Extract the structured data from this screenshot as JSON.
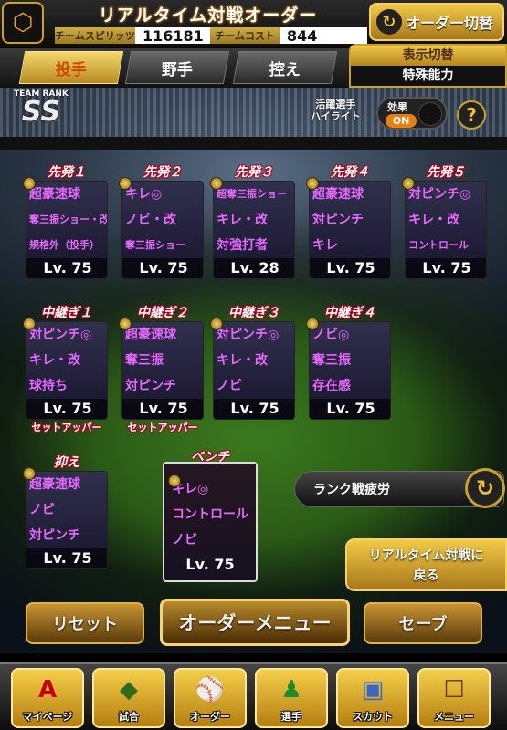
{
  "header": {
    "title": "リアルタイム対戦オーダー",
    "team_spirit_label": "チームスピリッツ",
    "team_spirit_value": "116181",
    "team_cost_label": "チームコスト",
    "team_cost_value": "844",
    "order_change_label": "オーダー切替"
  },
  "tabs": [
    {
      "label": "投手",
      "active": true
    },
    {
      "label": "野手",
      "active": false
    },
    {
      "label": "控え",
      "active": false
    }
  ],
  "display_switch": {
    "title": "表示切替",
    "value": "特殊能力"
  },
  "team_rank": {
    "label": "TEAM RANK",
    "value": "SS"
  },
  "highlight": {
    "label_line1": "活躍選手",
    "label_line2": "ハイライト",
    "effect_label": "効果",
    "state": "ON"
  },
  "starters": [
    {
      "pos": "先発１",
      "abilities": [
        "超豪速球",
        "奪三振ショー・改",
        "規格外（投手）"
      ],
      "level": "Lv. 75"
    },
    {
      "pos": "先発２",
      "abilities": [
        "キレ◎",
        "ノビ・改",
        "奪三振ショー"
      ],
      "level": "Lv. 75"
    },
    {
      "pos": "先発３",
      "abilities": [
        "超奪三振ショー",
        "キレ・改",
        "対強打者"
      ],
      "level": "Lv. 28"
    },
    {
      "pos": "先発４",
      "abilities": [
        "超豪速球",
        "対ピンチ",
        "キレ"
      ],
      "level": "Lv. 75"
    },
    {
      "pos": "先発５",
      "abilities": [
        "対ピンチ◎",
        "キレ・改",
        "コントロール"
      ],
      "level": "Lv. 75"
    }
  ],
  "relievers": [
    {
      "pos": "中継ぎ１",
      "abilities": [
        "対ピンチ◎",
        "キレ・改",
        "球持ち"
      ],
      "level": "Lv. 75",
      "sub": "セットアッパー"
    },
    {
      "pos": "中継ぎ２",
      "abilities": [
        "超豪速球",
        "奪三振",
        "対ピンチ"
      ],
      "level": "Lv. 75",
      "sub": "セットアッパー"
    },
    {
      "pos": "中継ぎ３",
      "abilities": [
        "対ピンチ◎",
        "キレ・改",
        "ノビ"
      ],
      "level": "Lv. 75",
      "sub": ""
    },
    {
      "pos": "中継ぎ４",
      "abilities": [
        "ノビ◎",
        "奪三振",
        "存在感"
      ],
      "level": "Lv. 75",
      "sub": ""
    }
  ],
  "closer": {
    "pos": "抑え",
    "abilities": [
      "超豪速球",
      "ノビ",
      "対ピンチ"
    ],
    "level": "Lv. 75"
  },
  "bench": {
    "pos": "ベンチ",
    "abilities": [
      "キレ◎",
      "コントロール",
      "ノビ"
    ],
    "level": "Lv. 75"
  },
  "rank_fatigue_label": "ランク戦疲労",
  "back_button": {
    "line1": "リアルタイム対戦に",
    "line2": "戻る"
  },
  "buttons": {
    "reset": "リセット",
    "order_menu": "オーダーメニュー",
    "save": "セーブ"
  },
  "nav": [
    {
      "label": "マイページ",
      "icon": "mypage-icon"
    },
    {
      "label": "試合",
      "icon": "stadium-icon"
    },
    {
      "label": "オーダー",
      "icon": "order-icon"
    },
    {
      "label": "選手",
      "icon": "player-icon"
    },
    {
      "label": "スカウト",
      "icon": "scout-icon"
    },
    {
      "label": "メニュー",
      "icon": "menu-icon"
    }
  ],
  "colors": {
    "accent": "#f0c030",
    "ability_text": "#e868ff",
    "position_outline": "#b4001c"
  }
}
